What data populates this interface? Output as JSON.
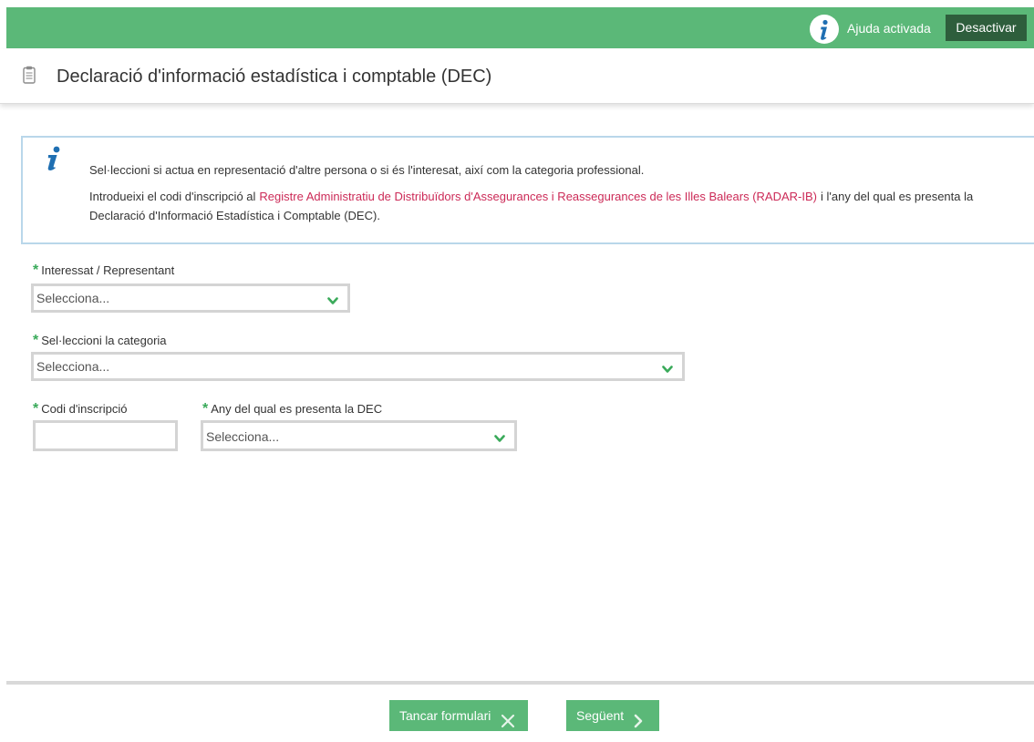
{
  "topbar": {
    "help_status": "Ajuda activada",
    "deactivate_label": "Desactivar"
  },
  "header": {
    "title": "Declaració d'informació estadística i comptable (DEC)"
  },
  "info": {
    "line1": "Sel·leccioni si actua en representació d'altre persona o si és l'interesat, així com la categoria professional.",
    "line2_before": "Introdueixi el codi d'inscripció al",
    "line2_link": "Registre Administratiu de Distribuïdors d'Assegurances i Reassegurances de les Illes Balears (RADAR-IB)",
    "line2_after": "i l'any del qual es presenta la Declaració d'Informació Estadística i Comptable (DEC)."
  },
  "form": {
    "required_mark": "*",
    "interessat": {
      "label": "Interessat / Representant",
      "value": "Selecciona..."
    },
    "categoria": {
      "label": "Sel·leccioni la categoria",
      "value": "Selecciona..."
    },
    "codi": {
      "label": "Codi d'inscripció",
      "value": ""
    },
    "any": {
      "label": "Any del qual es presenta la DEC",
      "value": "Selecciona..."
    }
  },
  "footer": {
    "close_label": "Tancar formulari",
    "next_label": "Següent"
  },
  "colors": {
    "brand_green": "#5bb878",
    "dark_green": "#2e5e3c",
    "link": "#cc2a57",
    "info_border": "#b9d7ea"
  },
  "icons": [
    "info-icon",
    "clipboard-icon",
    "chevron-down-icon",
    "close-x-icon",
    "chevron-right-icon"
  ]
}
